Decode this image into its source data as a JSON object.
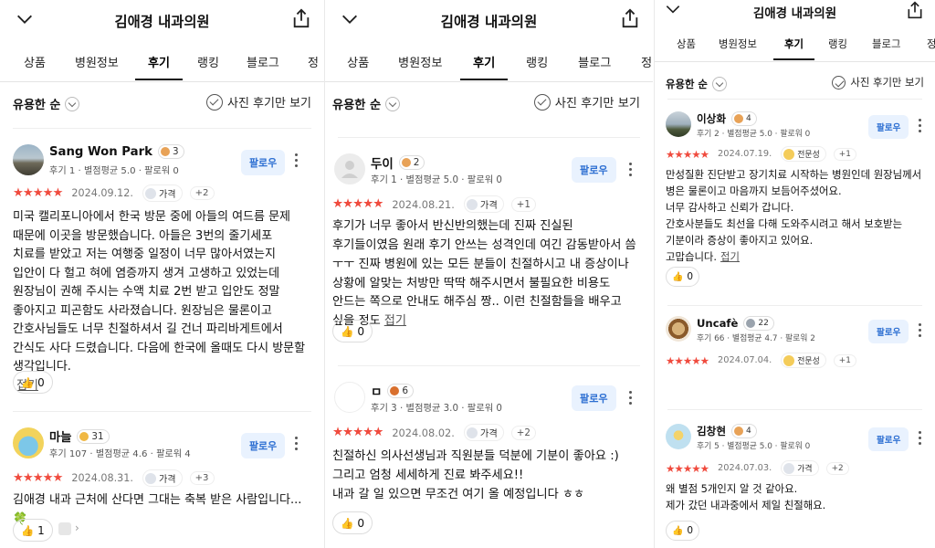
{
  "panels": [
    {
      "title": "김애경 내과의원",
      "tabs": [
        "상품",
        "병원정보",
        "후기",
        "랭킹",
        "블로그",
        "정"
      ],
      "active_tab": "후기",
      "sort_label": "유용한 순",
      "photo_only_label": "사진 후기만 보기",
      "follow_label": "팔로우",
      "fold_label": "접기",
      "reviews": [
        {
          "name": "Sang Won Park",
          "badge": "3",
          "badge_color": "#e8a257",
          "meta": "후기 1 · 별점평균 5.0 · 팔로워 0",
          "stars": "★★★★★",
          "date": "2024.09.12.",
          "keyword": "가격",
          "keyword_more": "+2",
          "text": "미국 캘리포니아에서 한국 방문 중에 아들의 여드름 문제 때문에 이곳을 방문했습니다. 아들은 3번의 줄기세포 치료를 받았고 저는 여행중 일정이 너무 많아서였는지 입안이 다 헐고 혀에 염증까지 생겨 고생하고 있었는데 원장님이 권해 주시는 수액 치료 2번 받고 입안도 정말 좋아지고 피곤함도 사라졌습니다. 원장님은 물론이고 간호사님들도 너무 친절하셔서 길 건너 파리바게트에서 간식도 사다 드렸습니다. 다음에 한국에 올때도 다시 방문할 생각입니다.",
          "likes": "0"
        },
        {
          "name": "마늘",
          "badge": "31",
          "badge_color": "#f0b843",
          "meta": "후기 107 · 별점평균 4.6 · 팔로워 4",
          "stars": "★★★★★",
          "date": "2024.08.31.",
          "keyword": "가격",
          "keyword_more": "+3",
          "text": "김애경 내과 근처에 산다면 그대는 축복 받은 사람입니다...🍀",
          "likes": "1"
        }
      ]
    },
    {
      "title": "김애경 내과의원",
      "tabs": [
        "상품",
        "병원정보",
        "후기",
        "랭킹",
        "블로그",
        "정"
      ],
      "active_tab": "후기",
      "sort_label": "유용한 순",
      "photo_only_label": "사진 후기만 보기",
      "follow_label": "팔로우",
      "fold_label": "접기",
      "reviews": [
        {
          "name": "두이",
          "badge": "2",
          "badge_color": "#e8a257",
          "meta": "후기 1 · 별점평균 5.0 · 팔로워 0",
          "stars": "★★★★★",
          "date": "2024.08.21.",
          "keyword": "가격",
          "keyword_more": "+1",
          "text": "후기가 너무 좋아서 반신반의했는데 진짜 진실된 후기들이였음 원래 후기 안쓰는 성격인데 여긴 감동받아서 씀 ㅜㅜ 진짜 병원에 있는 모든 분들이 친절하시고 내 증상이나 상황에 알맞는 처방만 딱딱 해주시면서 불필요한 비용도 안드는 쪽으로 안내도 해주심 짱.. 이런 친절함들을 배우고 싶을 정도",
          "likes": "0"
        },
        {
          "name": "ㅁ",
          "badge": "6",
          "badge_color": "#d9702e",
          "meta": "후기 3 · 별점평균 3.0 · 팔로워 0",
          "stars": "★★★★★",
          "date": "2024.08.02.",
          "keyword": "가격",
          "keyword_more": "+2",
          "text_lines": [
            "친절하신 의사선생님과 직원분들 덕분에 기분이 좋아요 :)",
            "그리고 엄청 세세하게 진료 봐주세요!!",
            "내과 갈 일 있으면 무조건 여기 올 예정입니다 ㅎㅎ"
          ],
          "likes": "0"
        }
      ]
    },
    {
      "title": "김애경 내과의원",
      "tabs": [
        "상품",
        "병원정보",
        "후기",
        "랭킹",
        "블로그",
        "정"
      ],
      "active_tab": "후기",
      "sort_label": "유용한 순",
      "photo_only_label": "사진 후기만 보기",
      "follow_label": "팔로우",
      "fold_label": "접기",
      "reviews": [
        {
          "name": "이상화",
          "badge": "4",
          "badge_color": "#e8a257",
          "meta": "후기 2 · 별점평균 5.0 · 팔로워 0",
          "stars": "★★★★★",
          "date": "2024.07.19.",
          "keyword": "전문성",
          "keyword_more": "+1",
          "text_lines": [
            "만성질환 진단받고 장기치료 시작하는 병원인데 원장님께서 병은 물론이고 마음까지 보듬어주셨어요.",
            "너무 감사하고 신뢰가 갑니다.",
            "간호사분들도 최선을 다해 도와주시려고 해서 보호받는 기분이라 증상이 좋아지고 있어요.",
            "고맙습니다."
          ],
          "likes": "0"
        },
        {
          "name": "Uncafè",
          "badge": "22",
          "badge_color": "#9aa3ad",
          "meta": "후기 66 · 별점평균 4.7 · 팔로워 2",
          "stars": "★★★★★",
          "date": "2024.07.04.",
          "keyword": "전문성",
          "keyword_more": "+1",
          "likes": ""
        },
        {
          "name": "김창현",
          "badge": "4",
          "badge_color": "#e8a257",
          "meta": "후기 5 · 별점평균 5.0 · 팔로워 0",
          "stars": "★★★★★",
          "date": "2024.07.03.",
          "keyword": "가격",
          "keyword_more": "+2",
          "text_lines": [
            "왜 별점 5개인지 알 것 같아요.",
            "제가 갔던 내과중에서 제일 친절해요."
          ],
          "likes": "0"
        }
      ]
    }
  ]
}
